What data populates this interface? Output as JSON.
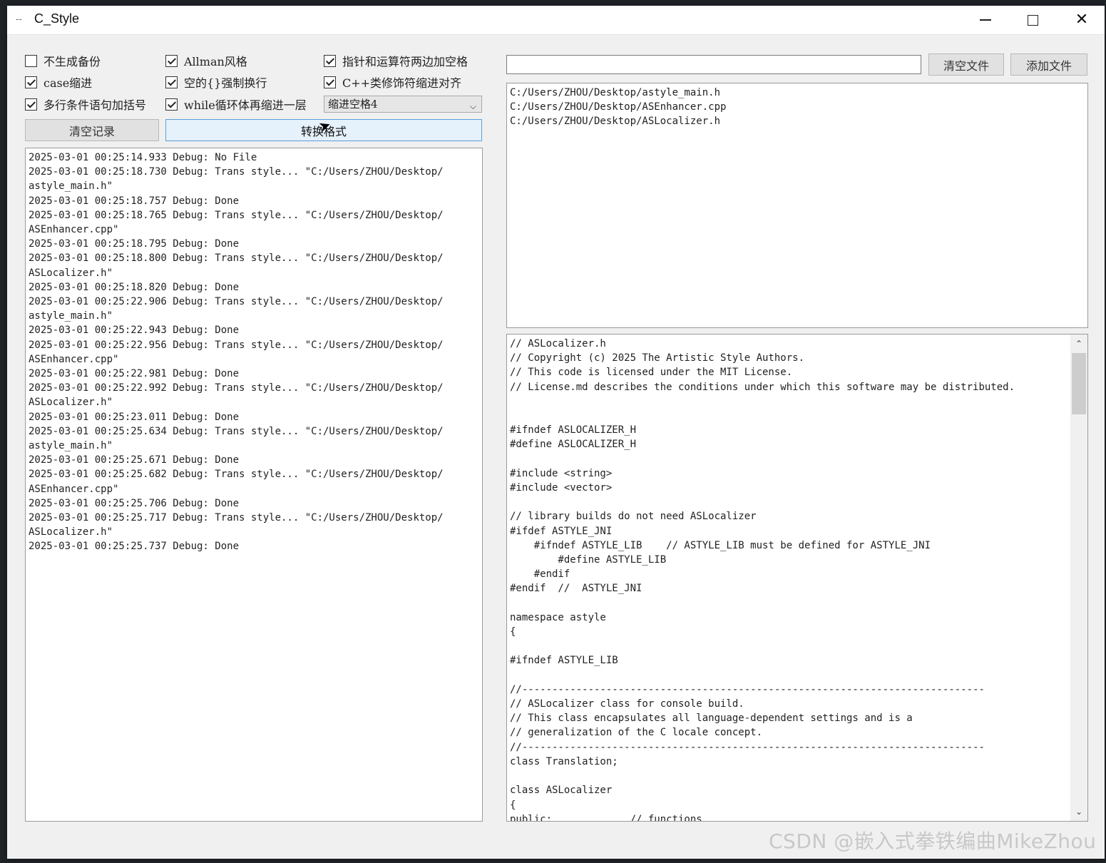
{
  "window": {
    "title": "C_Style",
    "app_icon": "--",
    "controls": {
      "minimize": "minimize-icon",
      "maximize": "maximize-icon",
      "close": "✕"
    }
  },
  "options": {
    "no_backup": {
      "label": "不生成备份",
      "checked": false
    },
    "case_indent": {
      "label": "case缩进",
      "checked": true
    },
    "multiline_brackets": {
      "label": "多行条件语句加括号",
      "checked": true
    },
    "allman": {
      "label": "Allman风格",
      "checked": true
    },
    "empty_brace_break": {
      "label": "空的{}强制换行",
      "checked": true
    },
    "while_indent": {
      "label": "while循环体再缩进一层",
      "checked": true
    },
    "pointer_spaces": {
      "label": "指针和运算符两边加空格",
      "checked": true
    },
    "cpp_modifier_indent": {
      "label": "C++类修饰符缩进对齐",
      "checked": true
    },
    "indent_select": {
      "value": "缩进空格4",
      "arrow": "⌵"
    }
  },
  "buttons": {
    "clear_log": "清空记录",
    "convert": "转换格式",
    "clear_files": "清空文件",
    "add_files": "添加文件"
  },
  "file_input": {
    "value": ""
  },
  "log_lines": [
    "2025-03-01 00:25:14.933 Debug: No File",
    "2025-03-01 00:25:18.730 Debug: Trans style... \"C:/Users/ZHOU/Desktop/",
    "astyle_main.h\"",
    "2025-03-01 00:25:18.757 Debug: Done",
    "2025-03-01 00:25:18.765 Debug: Trans style... \"C:/Users/ZHOU/Desktop/",
    "ASEnhancer.cpp\"",
    "2025-03-01 00:25:18.795 Debug: Done",
    "2025-03-01 00:25:18.800 Debug: Trans style... \"C:/Users/ZHOU/Desktop/",
    "ASLocalizer.h\"",
    "2025-03-01 00:25:18.820 Debug: Done",
    "2025-03-01 00:25:22.906 Debug: Trans style... \"C:/Users/ZHOU/Desktop/",
    "astyle_main.h\"",
    "2025-03-01 00:25:22.943 Debug: Done",
    "2025-03-01 00:25:22.956 Debug: Trans style... \"C:/Users/ZHOU/Desktop/",
    "ASEnhancer.cpp\"",
    "2025-03-01 00:25:22.981 Debug: Done",
    "2025-03-01 00:25:22.992 Debug: Trans style... \"C:/Users/ZHOU/Desktop/",
    "ASLocalizer.h\"",
    "2025-03-01 00:25:23.011 Debug: Done",
    "2025-03-01 00:25:25.634 Debug: Trans style... \"C:/Users/ZHOU/Desktop/",
    "astyle_main.h\"",
    "2025-03-01 00:25:25.671 Debug: Done",
    "2025-03-01 00:25:25.682 Debug: Trans style... \"C:/Users/ZHOU/Desktop/",
    "ASEnhancer.cpp\"",
    "2025-03-01 00:25:25.706 Debug: Done",
    "2025-03-01 00:25:25.717 Debug: Trans style... \"C:/Users/ZHOU/Desktop/",
    "ASLocalizer.h\"",
    "2025-03-01 00:25:25.737 Debug: Done"
  ],
  "files": [
    "C:/Users/ZHOU/Desktop/astyle_main.h",
    "C:/Users/ZHOU/Desktop/ASEnhancer.cpp",
    "C:/Users/ZHOU/Desktop/ASLocalizer.h"
  ],
  "code_lines": [
    "// ASLocalizer.h",
    "// Copyright (c) 2025 The Artistic Style Authors.",
    "// This code is licensed under the MIT License.",
    "// License.md describes the conditions under which this software may be distributed.",
    "",
    "",
    "#ifndef ASLOCALIZER_H",
    "#define ASLOCALIZER_H",
    "",
    "#include <string>",
    "#include <vector>",
    "",
    "// library builds do not need ASLocalizer",
    "#ifdef ASTYLE_JNI",
    "    #ifndef ASTYLE_LIB    // ASTYLE_LIB must be defined for ASTYLE_JNI",
    "        #define ASTYLE_LIB",
    "    #endif",
    "#endif  //  ASTYLE_JNI",
    "",
    "namespace astyle",
    "{",
    "",
    "#ifndef ASTYLE_LIB",
    "",
    "//-----------------------------------------------------------------------------",
    "// ASLocalizer class for console build.",
    "// This class encapsulates all language-dependent settings and is a",
    "// generalization of the C locale concept.",
    "//-----------------------------------------------------------------------------",
    "class Translation;",
    "",
    "class ASLocalizer",
    "{",
    "public:             // functions"
  ],
  "scrollbar": {
    "up": "⌃",
    "down": "⌄",
    "position": 0.0
  },
  "watermark": "CSDN @嵌入式拳铁编曲MikeZhou"
}
